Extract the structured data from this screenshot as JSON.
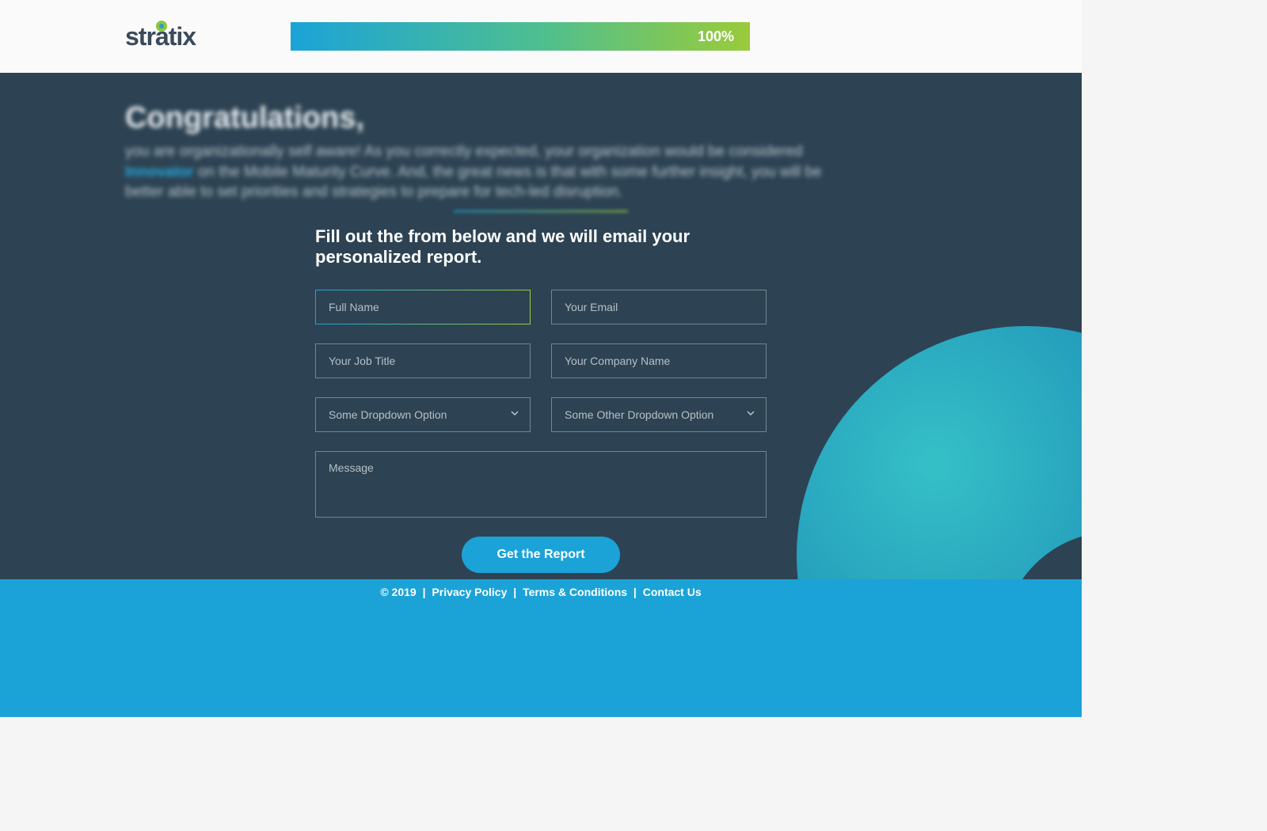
{
  "header": {
    "logo_text": "stratix",
    "progress_label": "100%"
  },
  "hero": {
    "heading": "Congratulations,",
    "para_before": "you are organizationally self aware!  As you correctly expected, your organization would be considered ",
    "para_highlight": "Innovator",
    "para_after": " on the Mobile Maturity Curve.  And, the great news is that with some further insight, you will be better able to set priorities and strategies to prepare for tech-led disruption."
  },
  "form": {
    "title": "Fill out the from below and we will email your personalized report.",
    "full_name_placeholder": "Full Name",
    "email_placeholder": "Your Email",
    "job_title_placeholder": "Your Job Title",
    "company_placeholder": "Your Company Name",
    "dropdown1_placeholder": "Some Dropdown Option",
    "dropdown2_placeholder": "Some Other Dropdown Option",
    "message_placeholder": "Message",
    "submit_label": "Get the Report"
  },
  "footer": {
    "copyright": "© 2019",
    "sep": " | ",
    "privacy": "Privacy Policy",
    "terms": "Terms & Conditions",
    "contact": "Contact Us"
  }
}
